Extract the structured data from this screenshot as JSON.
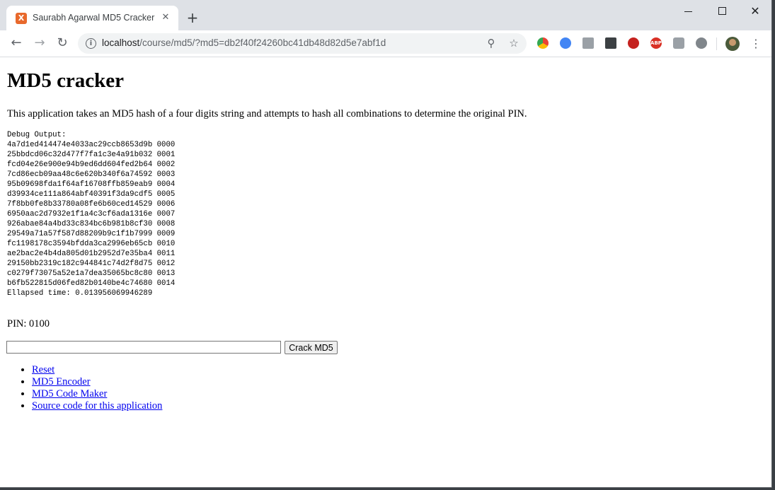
{
  "browser": {
    "tab": {
      "favicon_letter": "X",
      "title": "Saurabh Agarwal MD5 Cracker"
    },
    "url": {
      "host": "localhost",
      "path": "/course/md5/?md5=db2f40f24260bc41db48d82d5e7abf1d"
    }
  },
  "page": {
    "heading": "MD5 cracker",
    "description": "This application takes an MD5 hash of a four digits string and attempts to hash all combinations to determine the original PIN.",
    "debug_label": "Debug Output:",
    "debug_lines": [
      "4a7d1ed414474e4033ac29ccb8653d9b 0000",
      "25bbdcd06c32d477f7fa1c3e4a91b032 0001",
      "fcd04e26e900e94b9ed6dd604fed2b64 0002",
      "7cd86ecb09aa48c6e620b340f6a74592 0003",
      "95b09698fda1f64af16708ffb859eab9 0004",
      "d39934ce111a864abf40391f3da9cdf5 0005",
      "7f8bb0fe8b33780a08fe6b60ced14529 0006",
      "6950aac2d7932e1f1a4c3cf6ada1316e 0007",
      "926abae84a4bd33c834bc6b981b8cf30 0008",
      "29549a71a57f587d88209b9c1f1b7999 0009",
      "fc1198178c3594bfdda3ca2996eb65cb 0010",
      "ae2bac2e4b4da805d01b2952d7e35ba4 0011",
      "29150bb2319c182c944841c74d2f8d75 0012",
      "c0279f73075a52e1a7dea35065bc8c80 0013",
      "b6fb522815d06fed82b0140be4c74680 0014"
    ],
    "elapsed": "Ellapsed time: 0.013956069946289",
    "pin": "PIN: 0100",
    "form": {
      "input_value": "",
      "button_label": "Crack MD5"
    },
    "links": [
      "Reset",
      "MD5 Encoder",
      "MD5 Code Maker",
      "Source code for this application"
    ]
  }
}
